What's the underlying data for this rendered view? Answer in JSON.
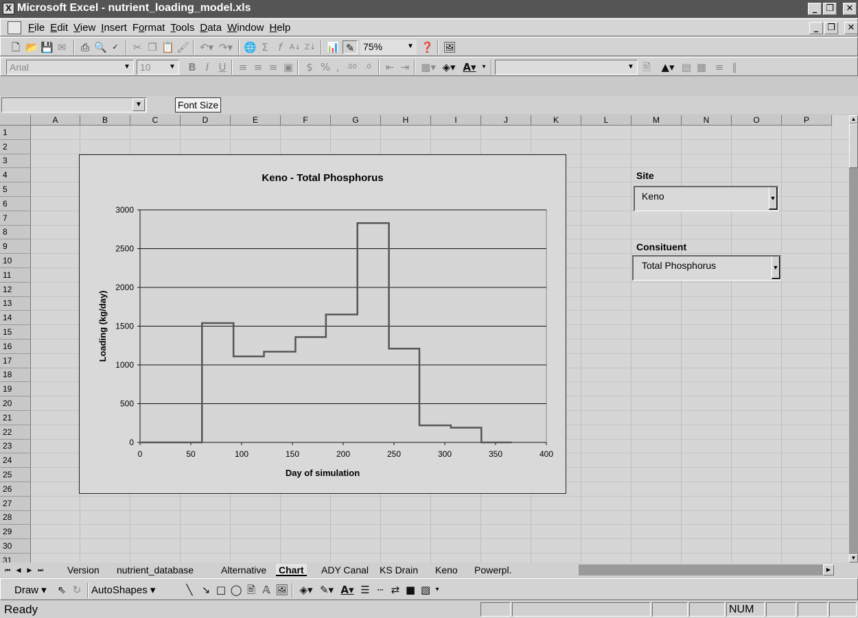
{
  "window": {
    "title": "Microsoft Excel - nutrient_loading_model.xls"
  },
  "menu": [
    "File",
    "Edit",
    "View",
    "Insert",
    "Format",
    "Tools",
    "Data",
    "Window",
    "Help"
  ],
  "menu_underline": [
    "F",
    "E",
    "V",
    "I",
    "o",
    "T",
    "D",
    "W",
    "H"
  ],
  "toolbar": {
    "zoom": "75%"
  },
  "format_toolbar": {
    "font": "Arial",
    "size": "10"
  },
  "tooltip": "Font Size",
  "columns": [
    "A",
    "B",
    "C",
    "D",
    "E",
    "F",
    "G",
    "H",
    "I",
    "J",
    "K",
    "L",
    "M",
    "N",
    "O",
    "P"
  ],
  "rows": [
    "1",
    "2",
    "3",
    "4",
    "5",
    "6",
    "7",
    "8",
    "9",
    "10",
    "11",
    "12",
    "13",
    "14",
    "15",
    "16",
    "17",
    "18",
    "19",
    "20",
    "21",
    "22",
    "23",
    "24",
    "25",
    "26",
    "27",
    "28",
    "29",
    "30",
    "31"
  ],
  "controls": {
    "site_label": "Site",
    "site_value": "Keno",
    "constituent_label": "Consituent",
    "constituent_value": "Total Phosphorus"
  },
  "sheet_tabs": [
    "Version",
    "nutrient_database",
    "Alternative",
    "Chart",
    "ADY Canal",
    "KS Drain",
    "Keno",
    "Powerpl."
  ],
  "active_tab": "Chart",
  "drawing_toolbar": {
    "draw": "Draw",
    "autoshapes": "AutoShapes"
  },
  "status": {
    "ready": "Ready",
    "num": "NUM"
  },
  "chart_data": {
    "type": "line",
    "title": "Keno - Total Phosphorus",
    "xlabel": "Day of simulation",
    "ylabel": "Loading (kg/day)",
    "xlim": [
      0,
      400
    ],
    "ylim": [
      0,
      3000
    ],
    "xticks": [
      0,
      50,
      100,
      150,
      200,
      250,
      300,
      350,
      400
    ],
    "yticks": [
      0,
      500,
      1000,
      1500,
      2000,
      2500,
      3000
    ],
    "grid": "horizontal",
    "step": true,
    "series": [
      {
        "x": [
          0,
          61,
          92,
          122,
          153,
          183,
          214,
          245,
          275,
          306,
          336,
          366
        ],
        "y": [
          0,
          1540,
          1110,
          1170,
          1360,
          1650,
          2830,
          1210,
          220,
          190,
          0,
          0
        ]
      }
    ]
  }
}
